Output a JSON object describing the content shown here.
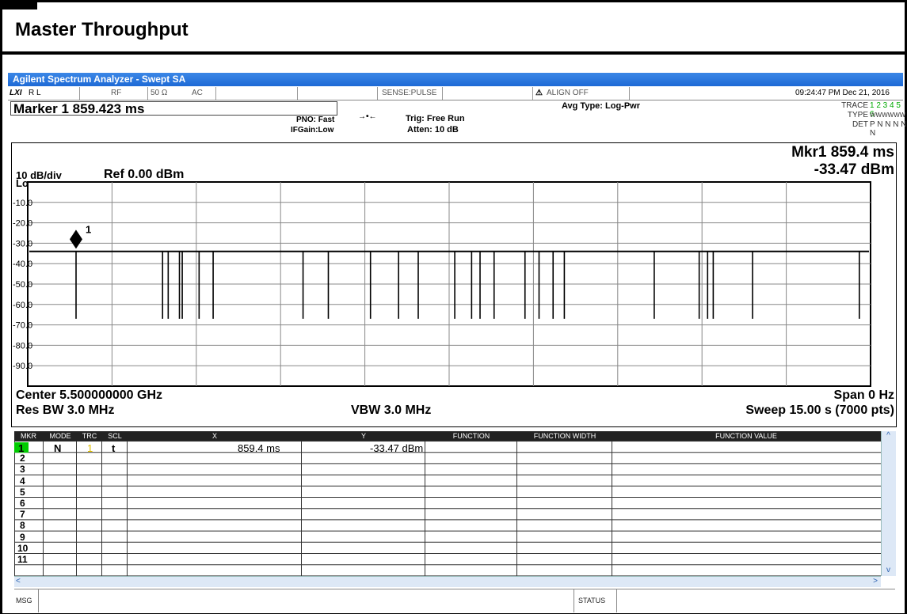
{
  "page": {
    "title": "Master  Throughput"
  },
  "window": {
    "title": "Agilent Spectrum Analyzer - Swept SA"
  },
  "status_bar": {
    "lxi": "LXI",
    "rl": "R L",
    "rf": "RF",
    "impedance": "50 Ω",
    "coupling": "AC",
    "sense": "SENSE:PULSE",
    "align": "ALIGN OFF",
    "datetime": "09:24:47 PM Dec 21, 2016"
  },
  "settings": {
    "marker_readout": "Marker 1  859.423 ms",
    "pno": "PNO: Fast",
    "ifgain": "IFGain:Low",
    "trig": "Trig: Free Run",
    "atten": "Atten: 10 dB",
    "avg_type": "Avg Type: Log-Pwr",
    "trace_label": "TRACE",
    "trace_nums": "1 2 3 4 5 6",
    "type_label": "TYPE",
    "type_vals": "WWWWWW",
    "det_label": "DET",
    "det_vals": "P N N N N N"
  },
  "graph": {
    "scale": "10 dB/div",
    "ref": "Ref 0.00 dBm",
    "log": "Log",
    "mkr_line1": "Mkr1 859.4 ms",
    "mkr_line2": "-33.47 dBm",
    "marker_label": "1",
    "center": "Center 5.500000000 GHz",
    "span": "Span 0 Hz",
    "rbw": "Res BW 3.0 MHz",
    "vbw": "VBW 3.0 MHz",
    "sweep": "Sweep  15.00 s (7000 pts)"
  },
  "chart_data": {
    "type": "line",
    "title": "",
    "xlabel": "",
    "ylabel": "",
    "y_ticks": [
      "-10.0",
      "-20.0",
      "-30.0",
      "-40.0",
      "-50.0",
      "-60.0",
      "-70.0",
      "-80.0",
      "-90.0"
    ],
    "ylim": [
      -100,
      0
    ],
    "xlim_s": [
      0,
      15
    ],
    "baseline_dbm": -34,
    "dip_floor_dbm": -67,
    "marker": {
      "x_ms": 859.4,
      "y_dbm": -33.47
    },
    "dips_s": [
      0.86,
      2.4,
      2.5,
      2.7,
      2.75,
      3.05,
      3.3,
      4.9,
      5.35,
      6.1,
      6.6,
      6.95,
      7.6,
      7.9,
      8.05,
      8.3,
      8.85,
      9.1,
      9.35,
      9.55,
      11.15,
      11.95,
      12.1,
      12.2,
      12.9,
      14.8
    ],
    "grid": true
  },
  "table": {
    "headers": [
      "MKR",
      "MODE",
      "TRC",
      "SCL",
      "X",
      "Y",
      "FUNCTION",
      "FUNCTION WIDTH",
      "FUNCTION VALUE"
    ],
    "row1": {
      "mkr": "1",
      "mode": "N",
      "trc": "1",
      "scl": "t",
      "x": "859.4 ms",
      "y": "-33.47 dBm"
    },
    "row_numbers": [
      "2",
      "3",
      "4",
      "5",
      "6",
      "7",
      "8",
      "9",
      "10",
      "11"
    ]
  },
  "footer": {
    "msg": "MSG",
    "status": "STATUS"
  },
  "colors": {
    "titlebar": "#2a78e0",
    "marker_row": "#00cc00",
    "trc_yellow": "#e0c000"
  }
}
